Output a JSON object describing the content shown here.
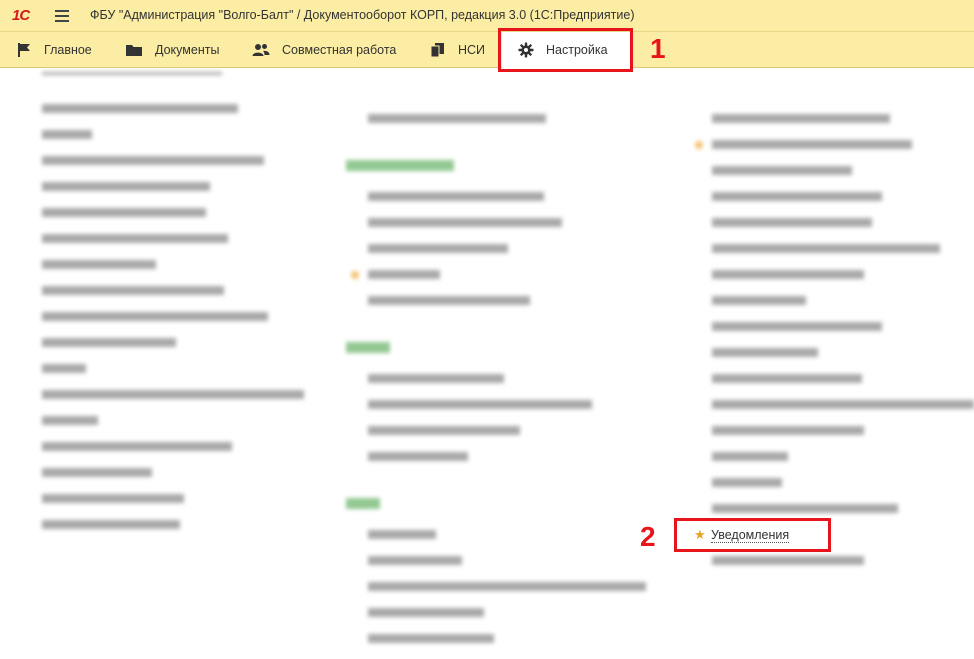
{
  "window": {
    "logo": "1С",
    "title": "ФБУ \"Администрация \"Волго-Балт\" / Документооборот КОРП, редакция 3.0  (1С:Предприятие)"
  },
  "sections": [
    {
      "label": "Главное",
      "icon": "flag-icon"
    },
    {
      "label": "Документы",
      "icon": "folder-icon"
    },
    {
      "label": "Совместная работа",
      "icon": "people-icon"
    },
    {
      "label": "НСИ",
      "icon": "copy-icon"
    },
    {
      "label": "Настройка",
      "icon": "gear-icon",
      "active": true
    }
  ],
  "callouts": [
    {
      "number": "1"
    },
    {
      "number": "2"
    }
  ],
  "colors": {
    "toolbar_bg": "#fbeda3",
    "callout": "#e8141b",
    "group_title": "#3b9a3b",
    "star": "#e9a321"
  },
  "notifications_item": {
    "label": "Уведомления",
    "starred": true
  }
}
